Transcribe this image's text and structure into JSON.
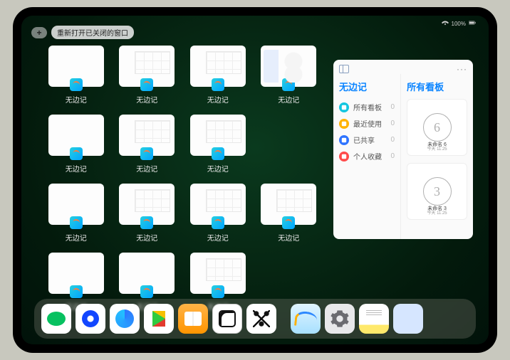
{
  "status": {
    "battery": "100%"
  },
  "reopen": {
    "plus": "+",
    "label": "重新打开已关闭的窗口"
  },
  "expose": {
    "app_label": "无边记",
    "windows": [
      {
        "variant": "blank"
      },
      {
        "variant": "grid"
      },
      {
        "variant": "grid"
      },
      {
        "variant": "boards"
      },
      {
        "variant": "blank"
      },
      {
        "variant": "grid"
      },
      {
        "variant": "grid"
      },
      {
        "variant": "blank"
      },
      {
        "variant": "grid"
      },
      {
        "variant": "grid"
      },
      {
        "variant": "grid"
      },
      {
        "variant": "blank"
      },
      {
        "variant": "blank"
      },
      {
        "variant": "grid"
      }
    ]
  },
  "freeform": {
    "sidebar_title": "无边记",
    "content_title": "所有看板",
    "items": [
      {
        "color": "#14c6e0",
        "label": "所有看板",
        "count": "0"
      },
      {
        "color": "#ffb300",
        "label": "最近使用",
        "count": "0"
      },
      {
        "color": "#2f74ff",
        "label": "已共享",
        "count": "0"
      },
      {
        "color": "#ff4b4b",
        "label": "个人收藏",
        "count": "0"
      }
    ],
    "boards": [
      {
        "sketch": "6",
        "name": "未命名 6",
        "time": "今天 11:25"
      },
      {
        "sketch": "3",
        "name": "未命名 3",
        "time": "今天 11:25"
      }
    ]
  },
  "dock": {
    "icons": [
      {
        "name": "wechat-icon",
        "cls": "di-wechat"
      },
      {
        "name": "browser1-icon",
        "cls": "di-blue1"
      },
      {
        "name": "browser2-icon",
        "cls": "di-blue2"
      },
      {
        "name": "video-icon",
        "cls": "di-play"
      },
      {
        "name": "books-icon",
        "cls": "di-books"
      },
      {
        "name": "game-icon",
        "cls": "di-dice"
      },
      {
        "name": "graph-icon",
        "cls": "di-nodes"
      }
    ],
    "suggested": [
      {
        "name": "freeform-icon",
        "cls": "di-freeform"
      },
      {
        "name": "settings-icon",
        "cls": "di-settings"
      },
      {
        "name": "notes-icon",
        "cls": "di-notes"
      },
      {
        "name": "app-library-icon",
        "cls": "di-multi"
      }
    ]
  }
}
